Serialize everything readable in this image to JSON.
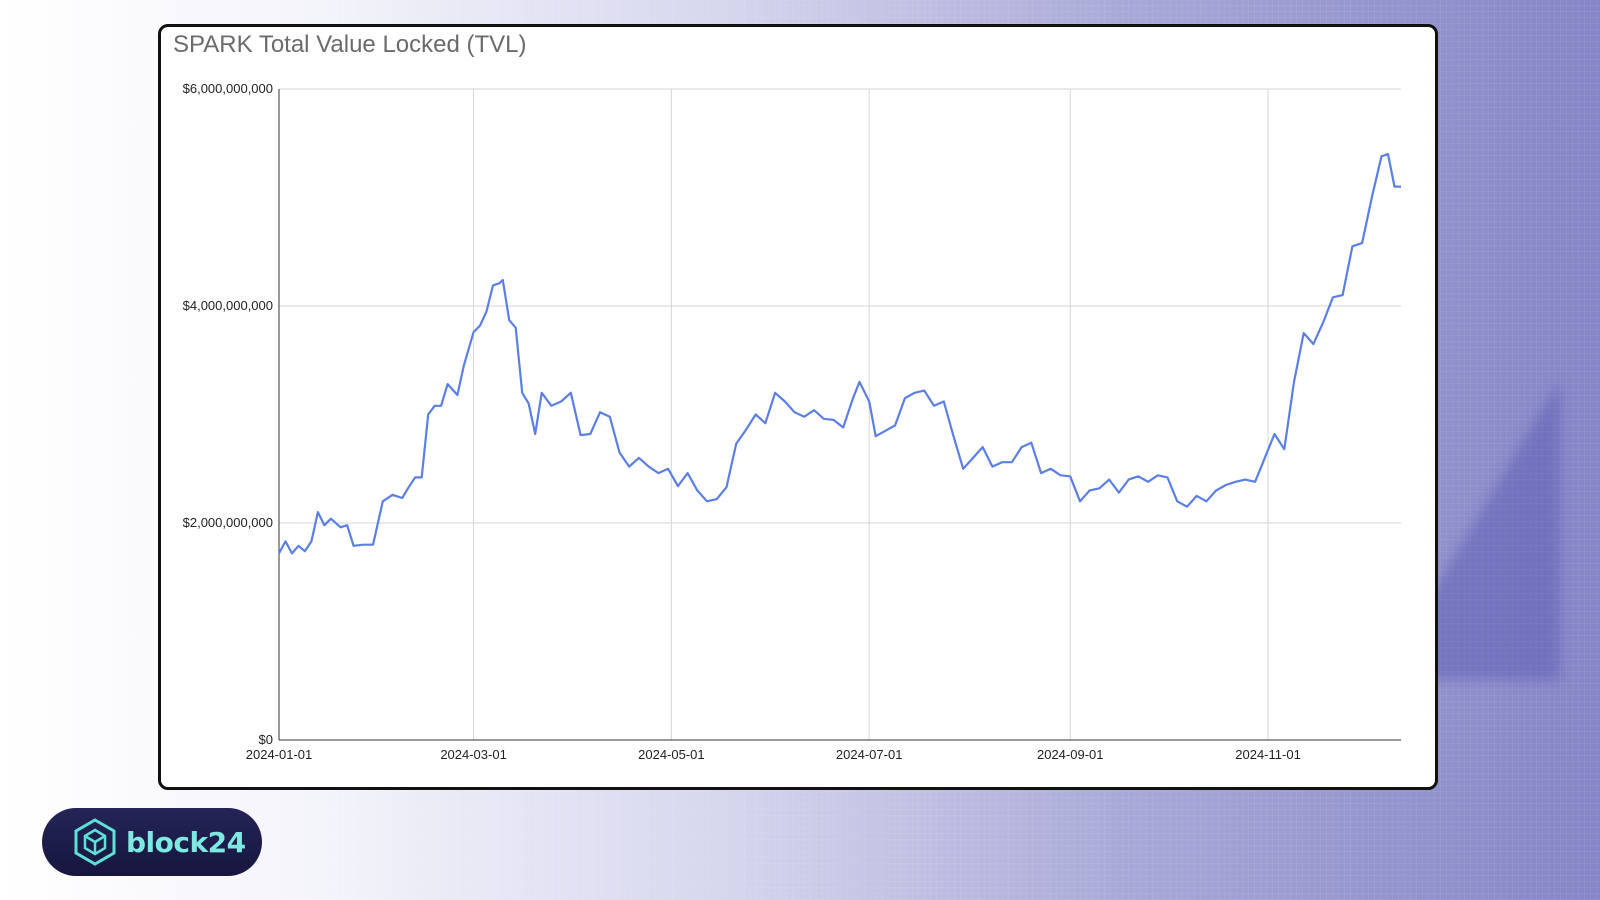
{
  "brand": {
    "name": "block24",
    "icon": "hexagon-cube-icon",
    "color": "#5fe0d6"
  },
  "chart_data": {
    "type": "line",
    "title": "SPARK Total Value Locked (TVL)",
    "xlabel": "",
    "ylabel": "",
    "x_tick_labels": [
      "2024-01-01",
      "2024-03-01",
      "2024-05-01",
      "2024-07-01",
      "2024-09-01",
      "2024-11-01"
    ],
    "x_ticks": [
      "2024-01-01",
      "2024-03-01",
      "2024-05-01",
      "2024-07-01",
      "2024-09-01",
      "2024-11-01"
    ],
    "y_tick_labels": [
      "$0",
      "$2,000,000,000",
      "$4,000,000,000",
      "$6,000,000,000"
    ],
    "y_ticks": [
      0,
      2000000000,
      4000000000,
      6000000000
    ],
    "xlim": [
      "2024-01-01",
      "2024-12-12"
    ],
    "ylim": [
      0,
      6000000000
    ],
    "grid": true,
    "legend": "none",
    "line_color": "#5b7fe3",
    "series": [
      {
        "x": [
          "2024-01-01",
          "2024-01-03",
          "2024-01-05",
          "2024-01-07",
          "2024-01-09",
          "2024-01-11",
          "2024-01-13",
          "2024-01-15",
          "2024-01-17",
          "2024-01-20",
          "2024-01-22",
          "2024-01-24",
          "2024-01-27",
          "2024-01-30",
          "2024-02-02",
          "2024-02-05",
          "2024-02-08",
          "2024-02-10",
          "2024-02-12",
          "2024-02-14",
          "2024-02-16",
          "2024-02-18",
          "2024-02-20",
          "2024-02-22",
          "2024-02-25",
          "2024-02-27",
          "2024-03-01",
          "2024-03-03",
          "2024-03-05",
          "2024-03-07",
          "2024-03-09",
          "2024-03-10",
          "2024-03-12",
          "2024-03-14",
          "2024-03-16",
          "2024-03-18",
          "2024-03-20",
          "2024-03-22",
          "2024-03-25",
          "2024-03-28",
          "2024-03-31",
          "2024-04-03",
          "2024-04-06",
          "2024-04-09",
          "2024-04-12",
          "2024-04-15",
          "2024-04-18",
          "2024-04-21",
          "2024-04-24",
          "2024-04-27",
          "2024-04-30",
          "2024-05-03",
          "2024-05-06",
          "2024-05-09",
          "2024-05-12",
          "2024-05-15",
          "2024-05-18",
          "2024-05-21",
          "2024-05-24",
          "2024-05-27",
          "2024-05-30",
          "2024-06-02",
          "2024-06-05",
          "2024-06-08",
          "2024-06-11",
          "2024-06-14",
          "2024-06-17",
          "2024-06-20",
          "2024-06-23",
          "2024-06-26",
          "2024-06-28",
          "2024-07-01",
          "2024-07-03",
          "2024-07-06",
          "2024-07-09",
          "2024-07-12",
          "2024-07-15",
          "2024-07-18",
          "2024-07-21",
          "2024-07-24",
          "2024-07-27",
          "2024-07-30",
          "2024-08-02",
          "2024-08-05",
          "2024-08-08",
          "2024-08-11",
          "2024-08-14",
          "2024-08-17",
          "2024-08-20",
          "2024-08-23",
          "2024-08-26",
          "2024-08-29",
          "2024-09-01",
          "2024-09-04",
          "2024-09-07",
          "2024-09-10",
          "2024-09-13",
          "2024-09-16",
          "2024-09-19",
          "2024-09-22",
          "2024-09-25",
          "2024-09-28",
          "2024-10-01",
          "2024-10-04",
          "2024-10-07",
          "2024-10-10",
          "2024-10-13",
          "2024-10-16",
          "2024-10-19",
          "2024-10-22",
          "2024-10-25",
          "2024-10-28",
          "2024-10-31",
          "2024-11-03",
          "2024-11-06",
          "2024-11-09",
          "2024-11-12",
          "2024-11-15",
          "2024-11-18",
          "2024-11-21",
          "2024-11-24",
          "2024-11-27",
          "2024-11-30",
          "2024-12-03",
          "2024-12-06",
          "2024-12-08",
          "2024-12-10",
          "2024-12-12"
        ],
        "y": [
          1720000000,
          1830000000,
          1720000000,
          1790000000,
          1740000000,
          1830000000,
          2100000000,
          1980000000,
          2040000000,
          1960000000,
          1980000000,
          1790000000,
          1800000000,
          1800000000,
          2200000000,
          2260000000,
          2230000000,
          2330000000,
          2420000000,
          2420000000,
          3000000000,
          3080000000,
          3080000000,
          3280000000,
          3180000000,
          3450000000,
          3760000000,
          3820000000,
          3950000000,
          4190000000,
          4210000000,
          4240000000,
          3870000000,
          3800000000,
          3200000000,
          3100000000,
          2820000000,
          3200000000,
          3080000000,
          3120000000,
          3200000000,
          2810000000,
          2820000000,
          3020000000,
          2980000000,
          2650000000,
          2520000000,
          2600000000,
          2520000000,
          2460000000,
          2500000000,
          2340000000,
          2460000000,
          2300000000,
          2200000000,
          2220000000,
          2330000000,
          2730000000,
          2860000000,
          3000000000,
          2920000000,
          3200000000,
          3120000000,
          3020000000,
          2980000000,
          3040000000,
          2960000000,
          2950000000,
          2880000000,
          3150000000,
          3300000000,
          3120000000,
          2800000000,
          2850000000,
          2900000000,
          3150000000,
          3200000000,
          3220000000,
          3080000000,
          3120000000,
          2800000000,
          2500000000,
          2600000000,
          2700000000,
          2520000000,
          2560000000,
          2560000000,
          2700000000,
          2740000000,
          2460000000,
          2500000000,
          2440000000,
          2430000000,
          2200000000,
          2300000000,
          2320000000,
          2400000000,
          2280000000,
          2400000000,
          2430000000,
          2380000000,
          2440000000,
          2420000000,
          2200000000,
          2150000000,
          2250000000,
          2200000000,
          2300000000,
          2350000000,
          2380000000,
          2400000000,
          2380000000,
          2600000000,
          2820000000,
          2680000000,
          3300000000,
          3750000000,
          3650000000,
          3850000000,
          4080000000,
          4100000000,
          4550000000,
          4580000000,
          5000000000,
          5380000000,
          5400000000,
          5100000000,
          5100000000
        ]
      }
    ]
  }
}
